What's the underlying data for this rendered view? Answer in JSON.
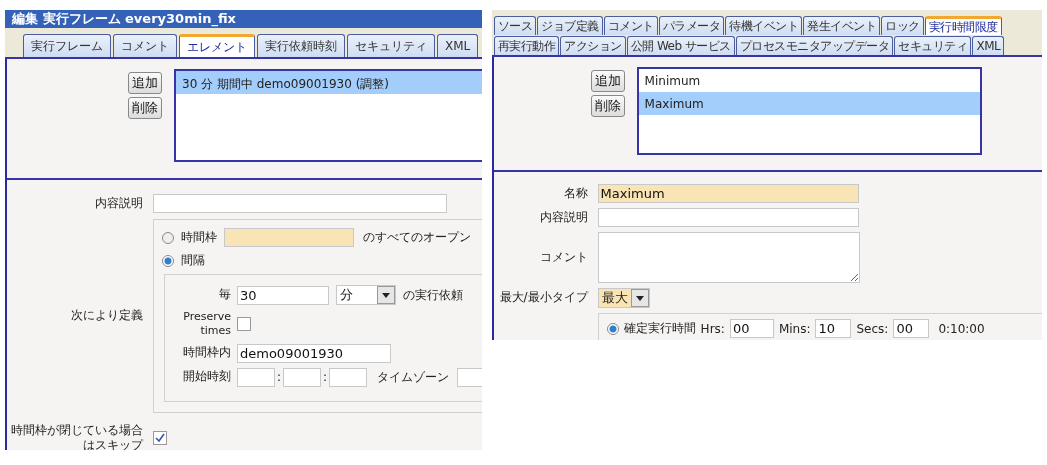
{
  "left": {
    "title": "編集 実行フレーム every30min_fix",
    "tabs": [
      {
        "label": "実行フレーム",
        "selected": false
      },
      {
        "label": "コメント",
        "selected": false
      },
      {
        "label": "エレメント",
        "selected": true
      },
      {
        "label": "実行依頼時刻",
        "selected": false
      },
      {
        "label": "セキュリティ",
        "selected": false
      },
      {
        "label": "XML",
        "selected": false
      }
    ],
    "buttons": [
      "追加",
      "削除"
    ],
    "items": [
      {
        "label": "30 分 期間中 demo09001930 (調整)",
        "selected": true
      }
    ],
    "description": {
      "label": "内容説明"
    },
    "define": {
      "label": "次により定義",
      "options": [
        {
          "kind": "timeframe",
          "label": "時間枠",
          "selected": false,
          "suffix": "のすべてのオープン"
        },
        {
          "kind": "interval",
          "label": "間隔",
          "selected": true
        }
      ],
      "every": {
        "label": "毎",
        "value": "30",
        "unit": "分",
        "suffix": "の実行依頼"
      },
      "preserve": {
        "label": "Preserve times",
        "checked": false
      },
      "within": {
        "label": "時間枠内",
        "value": "demo09001930"
      },
      "start": {
        "label": "開始時刻",
        "separators": [
          ":",
          ":"
        ]
      },
      "timezone": {
        "label": "タイムゾーン"
      }
    },
    "skip": {
      "label": "時間枠が閉じている場合はスキップ",
      "checked": true
    }
  },
  "right": {
    "tab_rows": [
      [
        {
          "label": "ソース",
          "selected": false
        },
        {
          "label": "ジョブ定義",
          "selected": false
        },
        {
          "label": "コメント",
          "selected": false
        },
        {
          "label": "パラメータ",
          "selected": false
        },
        {
          "label": "待機イベント",
          "selected": false
        },
        {
          "label": "発生イベント",
          "selected": false
        },
        {
          "label": "ロック",
          "selected": false
        },
        {
          "label": "実行時間限度",
          "selected": true
        }
      ],
      [
        {
          "label": "再実行動作",
          "selected": false
        },
        {
          "label": "アクション",
          "selected": false
        },
        {
          "label": "公開 Web サービス",
          "selected": false
        },
        {
          "label": "プロセスモニタアップデータ",
          "selected": false
        },
        {
          "label": "セキュリティ",
          "selected": false
        },
        {
          "label": "XML",
          "selected": false
        }
      ]
    ],
    "buttons": [
      "追加",
      "削除"
    ],
    "items": [
      {
        "label": "Minimum",
        "selected": false
      },
      {
        "label": "Maximum",
        "selected": true
      }
    ],
    "name": {
      "label": "名称",
      "value": "Maximum"
    },
    "description": {
      "label": "内容説明"
    },
    "comment": {
      "label": "コメント"
    },
    "type": {
      "label": "最大/最小タイプ",
      "value": "最大"
    },
    "run_time": {
      "label": "確定実行時間",
      "selected": true,
      "hrs_label": "Hrs:",
      "hrs": "00",
      "mins_label": "Mins:",
      "mins": "10",
      "secs_label": "Secs:",
      "secs": "00",
      "total": "0:10:00"
    }
  }
}
